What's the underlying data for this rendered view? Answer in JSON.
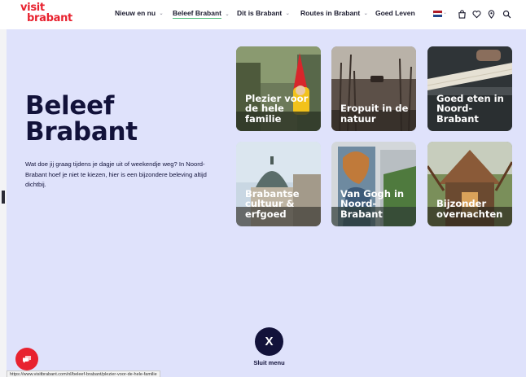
{
  "logo": {
    "line1": "visit",
    "line2": "brabant"
  },
  "nav": {
    "items": [
      {
        "label": "Nieuw en nu",
        "has_dropdown": true,
        "active": false
      },
      {
        "label": "Beleef Brabant",
        "has_dropdown": true,
        "active": true
      },
      {
        "label": "Dit is Brabant",
        "has_dropdown": true,
        "active": false
      },
      {
        "label": "Routes in Brabant",
        "has_dropdown": true,
        "active": false
      },
      {
        "label": "Goed Leven",
        "has_dropdown": false,
        "active": false
      }
    ],
    "icons": [
      "language-flag-nl",
      "shopping-bag-icon",
      "heart-icon",
      "location-pin-icon",
      "search-icon"
    ]
  },
  "menu": {
    "title_line1": "Beleef",
    "title_line2": "Brabant",
    "description": "Wat doe jij graag tijdens je dagje uit of weekendje weg? In Noord-Brabant hoef je niet te kiezen, hier is een bijzondere beleving altijd dichtbij.",
    "cards": [
      {
        "label": "Plezier voor de hele familie"
      },
      {
        "label": "Eropuit in de natuur"
      },
      {
        "label": "Goed eten in Noord-Brabant"
      },
      {
        "label": "Brabantse cultuur & erfgoed"
      },
      {
        "label": "Van Gogh in Noord-Brabant"
      },
      {
        "label": "Bijzonder overnachten"
      }
    ],
    "close_symbol": "X",
    "close_label": "Sluit menu"
  },
  "status_bar": {
    "url": "https://www.visitbrabant.com/nl/beleef-brabant/plezier-voor-de-hele-familie"
  },
  "colors": {
    "brand_red": "#e8222f",
    "navy": "#12123a",
    "panel_bg": "#dfe2fb",
    "active_underline": "#4cbf79"
  }
}
